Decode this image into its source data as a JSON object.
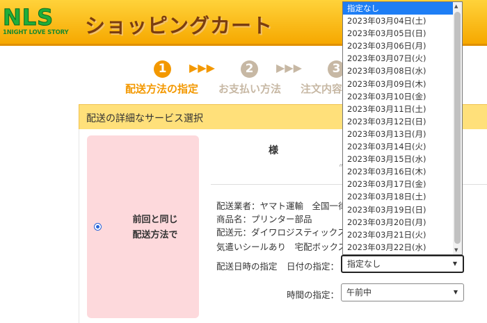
{
  "header": {
    "logo_letters": "NLS",
    "logo_tagline": "1NIGHT LOVE STORY",
    "title": "ショッピングカート"
  },
  "steps": [
    {
      "number": "1",
      "label": "配送方法の指定",
      "active": true
    },
    {
      "number": "2",
      "label": "お支払い方法",
      "active": false
    },
    {
      "number": "3",
      "label": "注文内容",
      "active": false
    }
  ],
  "step_arrows": "▶▶▶",
  "section": {
    "title": "配送の詳細なサービス選択"
  },
  "option": {
    "line1": "前回と同じ",
    "line2": "配送方法で"
  },
  "recipient": {
    "suffix": "様",
    "blur_mark": "〃"
  },
  "info_lines": [
    "配送業者：ヤマト運輸　全国一律",
    "商品名：プリンター部品",
    "配送元：ダイワロジスティックス",
    "気遣いシールあり　宅配ボックス"
  ],
  "delivery": {
    "main_label": "配送日時の指定",
    "date_label": "日付の指定：",
    "date_value": "指定なし",
    "time_label": "時間の指定：",
    "time_value": "午前中"
  },
  "dropdown_options": [
    "指定なし",
    "2023年03月04日(土)",
    "2023年03月05日(日)",
    "2023年03月06日(月)",
    "2023年03月07日(火)",
    "2023年03月08日(水)",
    "2023年03月09日(木)",
    "2023年03月10日(金)",
    "2023年03月11日(土)",
    "2023年03月12日(日)",
    "2023年03月13日(月)",
    "2023年03月14日(火)",
    "2023年03月15日(水)",
    "2023年03月16日(木)",
    "2023年03月17日(金)",
    "2023年03月18日(土)",
    "2023年03月19日(日)",
    "2023年03月20日(月)",
    "2023年03月21日(火)",
    "2023年03月22日(水)"
  ],
  "colors": {
    "active_step": "#f39800",
    "inactive_step": "#c7b8a4",
    "selected_option": "#1e7ef5"
  }
}
